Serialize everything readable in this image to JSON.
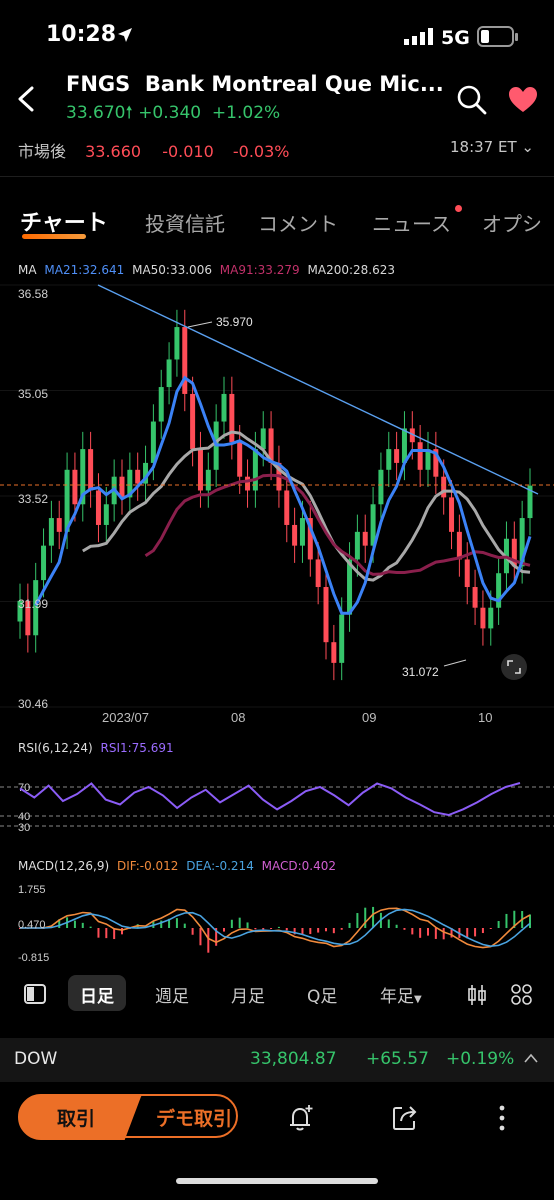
{
  "status_bar": {
    "time": "10:28",
    "network": "5G"
  },
  "header": {
    "symbol": "FNGS",
    "name": "Bank Montreal Que Mic...",
    "price": "33.670",
    "change": "+0.340",
    "change_pct": "+1.02%",
    "after_hours_label": "市場後",
    "after_hours_price": "33.660",
    "after_hours_change": "-0.010",
    "after_hours_pct": "-0.03%",
    "time": "18:37 ET"
  },
  "tabs": [
    "チャート",
    "投資信託",
    "コメント",
    "ニュース",
    "オプシ"
  ],
  "ma_legend": {
    "label": "MA",
    "ma21": "MA21:32.641",
    "ma50": "MA50:33.006",
    "ma91": "MA91:33.279",
    "ma200": "MA200:28.623"
  },
  "price_axis": [
    "36.58",
    "35.05",
    "33.52",
    "31.99",
    "30.46"
  ],
  "date_axis": [
    "2023/07",
    "08",
    "09",
    "10"
  ],
  "annotations": {
    "high": "35.970",
    "low": "31.072"
  },
  "rsi": {
    "label": "RSI(6,12,24)",
    "value": "RSI1:75.691",
    "levels": [
      "70",
      "40",
      "30"
    ]
  },
  "macd": {
    "label": "MACD(12,26,9)",
    "dif": "DIF:-0.012",
    "dea": "DEA:-0.214",
    "macd": "MACD:0.402",
    "levels": [
      "1.755",
      "0.470",
      "-0.815"
    ]
  },
  "periods": [
    "日足",
    "週足",
    "月足",
    "Q足",
    "年足"
  ],
  "ticker": {
    "name": "DOW",
    "value": "33,804.87",
    "change": "+65.57",
    "pct": "+0.19%"
  },
  "actions": {
    "trade": "取引",
    "demo": "デモ取引"
  },
  "colors": {
    "up": "#36c46b",
    "down": "#ff4d57",
    "ma21": "#3b82f6",
    "ma50": "#9a9a9a",
    "ma91": "#8a1f4c",
    "accent": "#e96f2a",
    "rsi": "#8b5cf6",
    "dif": "#f08a3c",
    "dea": "#4aa3e0"
  },
  "chart_data": [
    {
      "type": "candlestick",
      "title": "",
      "x_ticks": [
        "2023/07",
        "08",
        "09",
        "10"
      ],
      "ylim": [
        30.46,
        36.58
      ],
      "y_ticks": [
        36.58,
        35.05,
        33.52,
        31.99,
        30.46
      ],
      "annotations": [
        {
          "label": "35.970"
        },
        {
          "label": "31.072"
        }
      ],
      "close_series": [
        32.0,
        31.5,
        32.3,
        32.8,
        33.2,
        33.0,
        33.9,
        33.4,
        34.2,
        33.6,
        33.1,
        33.4,
        33.8,
        33.5,
        33.9,
        33.7,
        34.0,
        34.6,
        35.1,
        35.5,
        35.97,
        35.0,
        34.2,
        33.6,
        33.9,
        34.6,
        35.0,
        34.3,
        33.8,
        33.6,
        34.2,
        34.5,
        34.0,
        33.6,
        33.1,
        32.8,
        33.2,
        32.6,
        32.2,
        31.4,
        31.1,
        31.8,
        32.6,
        33.0,
        32.8,
        33.4,
        33.9,
        34.2,
        34.0,
        34.5,
        34.3,
        33.9,
        34.2,
        33.8,
        33.5,
        33.0,
        32.6,
        32.2,
        31.9,
        31.6,
        31.9,
        32.4,
        32.9,
        32.5,
        33.2,
        33.67
      ]
    },
    {
      "type": "line",
      "title": "RSI(6,12,24)",
      "series": [
        {
          "name": "RSI1",
          "values": [
            68,
            55,
            72,
            50,
            60,
            75,
            52,
            45,
            62,
            70,
            58,
            40,
            55,
            66,
            48,
            60,
            72,
            52,
            38,
            50,
            64,
            70,
            58,
            44,
            62,
            75,
            68,
            55,
            45,
            34,
            30,
            38,
            48,
            60,
            70,
            75.7
          ]
        }
      ]
    },
    {
      "type": "line",
      "title": "MACD(12,26,9)",
      "y_ticks": [
        1.755,
        0.47,
        -0.815
      ],
      "series": [
        {
          "name": "DIF",
          "values": []
        },
        {
          "name": "DEA",
          "values": []
        },
        {
          "name": "MACD",
          "values": []
        }
      ]
    }
  ]
}
